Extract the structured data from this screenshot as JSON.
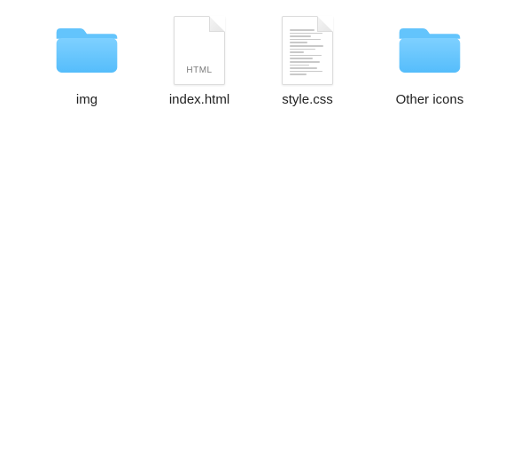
{
  "items": [
    {
      "label": "img",
      "type": "folder"
    },
    {
      "label": "index.html",
      "type": "html"
    },
    {
      "label": "style.css",
      "type": "text"
    },
    {
      "label": "Other icons",
      "type": "folder"
    }
  ],
  "file_badges": {
    "html": "HTML"
  }
}
